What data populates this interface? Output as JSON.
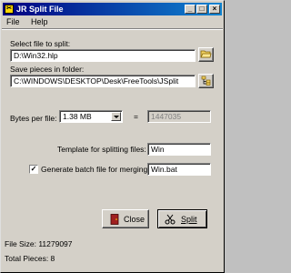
{
  "window": {
    "title": "JR Split File",
    "minimize_glyph": "_",
    "maximize_glyph": "□",
    "close_glyph": "×"
  },
  "menu": {
    "file": "File",
    "help": "Help"
  },
  "select_file": {
    "label": "Select file to split:",
    "value": "D:\\Win32.hlp",
    "browse_icon": "folder-open-icon"
  },
  "save_folder": {
    "label": "Save pieces in folder:",
    "value": "C:\\WINDOWS\\DESKTOP\\Desk\\FreeTools\\JSplit",
    "browse_icon": "folder-tree-icon"
  },
  "bytes_per_file": {
    "label": "Bytes per file:",
    "selected": "1.38  MB",
    "equals": "=",
    "bytes_value": "1447035"
  },
  "template": {
    "label": "Template for splitting files:",
    "value": "Win"
  },
  "batch": {
    "label": "Generate batch file for merging:",
    "checked_glyph": "✓",
    "value": "Win.bat"
  },
  "buttons": {
    "close": "Close",
    "split": "Split"
  },
  "status": {
    "file_size": "File Size: 11279097",
    "total_pieces": "Total Pieces: 8"
  },
  "colors": {
    "title_bar_start": "#000080",
    "title_bar_end": "#1084d0",
    "dialog_face": "#d4d0c8"
  }
}
